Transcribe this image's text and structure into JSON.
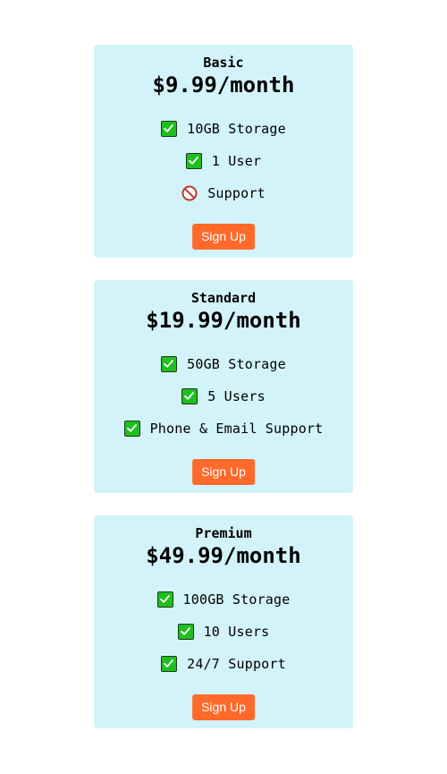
{
  "plans": [
    {
      "name": "Basic",
      "price": "$9.99/month",
      "features": [
        {
          "icon": "check-icon",
          "text": "10GB Storage"
        },
        {
          "icon": "no-entry-icon",
          "text": "1 User"
        },
        {
          "icon": "no-entry-icon",
          "text": "Support"
        }
      ],
      "button_label": "Sign Up"
    },
    {
      "name": "Standard",
      "price": "$19.99/month",
      "features": [
        {
          "icon": "check-icon",
          "text": "50GB Storage"
        },
        {
          "icon": "check-icon",
          "text": "5 Users"
        },
        {
          "icon": "check-icon",
          "text": "Phone & Email Support"
        }
      ],
      "button_label": "Sign Up"
    },
    {
      "name": "Premium",
      "price": "$49.99/month",
      "features": [
        {
          "icon": "check-icon",
          "text": "100GB Storage"
        },
        {
          "icon": "check-icon",
          "text": "10 Users"
        },
        {
          "icon": "check-icon",
          "text": "24/7 Support"
        }
      ],
      "button_label": "Sign Up"
    }
  ],
  "colors": {
    "card_background": "#d3f3fa",
    "button_background": "#ff6a2a",
    "check_green": "#1fbf1f"
  }
}
